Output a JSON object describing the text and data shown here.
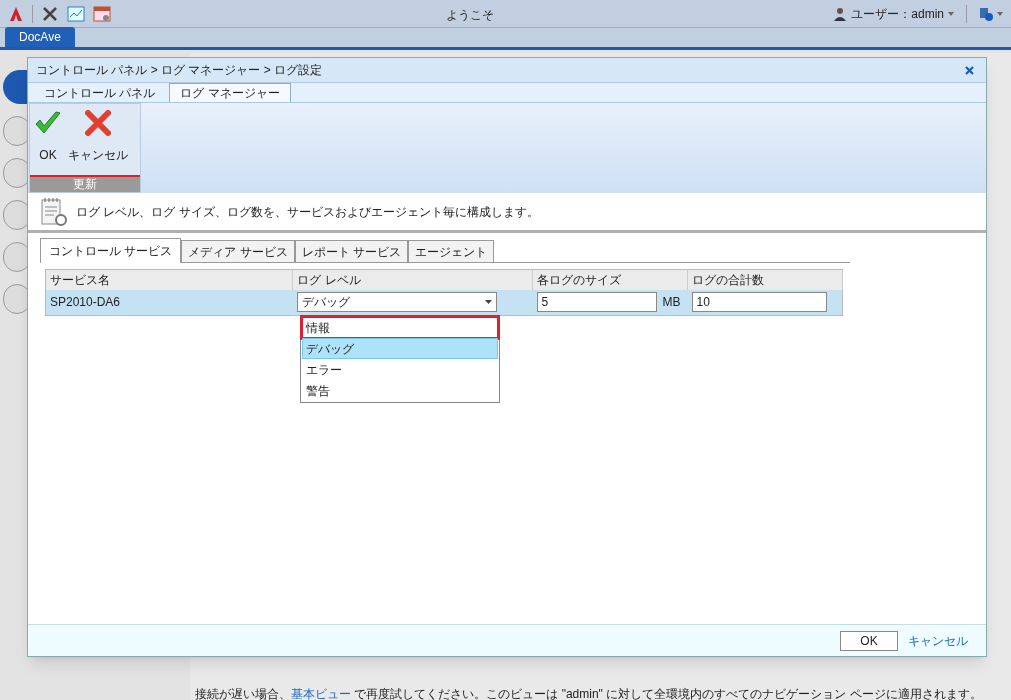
{
  "app": {
    "title": "ようこそ",
    "user": "ユーザー：admin",
    "tab": "DocAve"
  },
  "dialog": {
    "breadcrumb": "コントロール パネル > ログ マネージャー > ログ設定",
    "tabs": [
      {
        "label": "コントロール パネル",
        "selected": false
      },
      {
        "label": "ログ マネージャー",
        "selected": true
      }
    ],
    "ribbon": {
      "buttons": [
        {
          "label": "OK",
          "kind": "ok"
        },
        {
          "label": "キャンセル",
          "kind": "cancel"
        }
      ],
      "group": "更新"
    },
    "description": "ログ レベル、ログ サイズ、ログ数を、サービスおよびエージェント毎に構成します。",
    "service_tabs": [
      {
        "label": "コントロール サービス",
        "selected": true
      },
      {
        "label": "メディア サービス",
        "selected": false
      },
      {
        "label": "レポート サービス",
        "selected": false
      },
      {
        "label": "エージェント",
        "selected": false
      }
    ],
    "table": {
      "columns": [
        "サービス名",
        "ログ レベル",
        "各ログのサイズ",
        "ログの合計数"
      ],
      "rows": [
        {
          "service": "SP2010-DA6",
          "log_level": "デバッグ",
          "size": "5",
          "size_unit": "MB",
          "count": "10",
          "selected": true
        }
      ]
    },
    "dropdown": {
      "options": [
        {
          "label": "情報",
          "selected": false,
          "highlighted": true
        },
        {
          "label": "デバッグ",
          "selected": true,
          "highlighted": false
        },
        {
          "label": "エラー",
          "selected": false,
          "highlighted": false
        },
        {
          "label": "警告",
          "selected": false,
          "highlighted": false
        }
      ]
    },
    "footer": {
      "ok": "OK",
      "cancel": "キャンセル"
    }
  },
  "notice": {
    "before": "接続が遅い場合、",
    "link": "基本ビュー",
    "after": " で再度試してください。このビューは \"admin\" に対して全環境内のすべてのナビゲーション ページに適用されます。"
  }
}
